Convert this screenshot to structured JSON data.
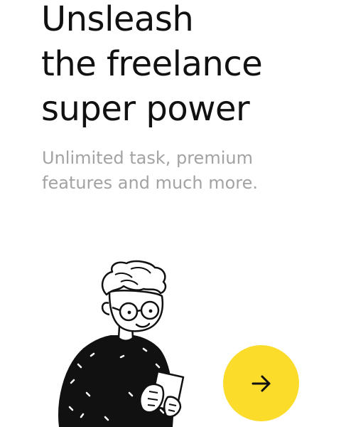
{
  "onboarding": {
    "headline_lines": [
      "Unsleash",
      "the freelance",
      "super power"
    ],
    "subtitle_lines": [
      "Unlimited task, premium",
      "features and much more."
    ],
    "next_button": {
      "icon": "arrow-right-icon",
      "color": "#fbdc2b"
    },
    "illustration": "person-with-phone-illustration"
  },
  "colors": {
    "headline": "#111111",
    "subtitle": "#a3a3a3",
    "accent": "#fbdc2b",
    "background": "#ffffff"
  }
}
